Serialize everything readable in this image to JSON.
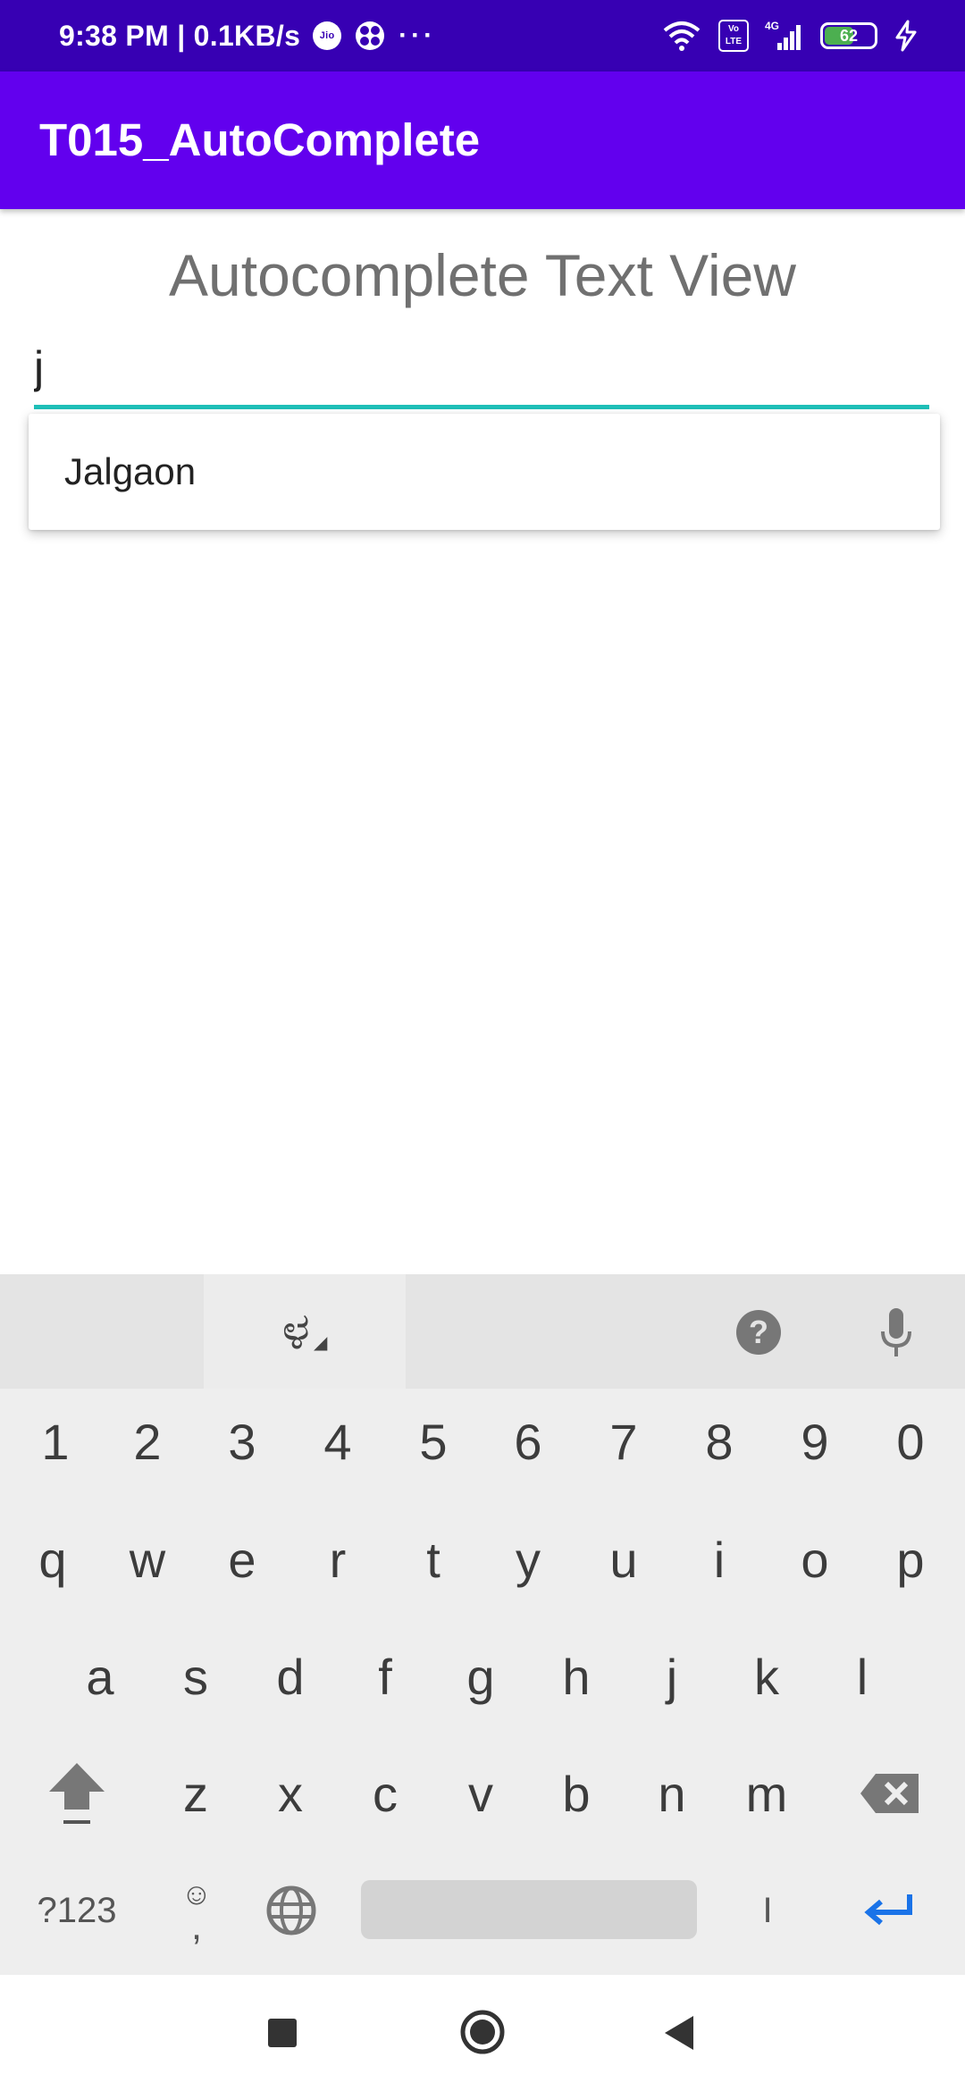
{
  "status_bar": {
    "time_speed": "9:38 PM | 0.1KB/s",
    "jio_label": "Jio",
    "more": "···",
    "volte_label": "Vo LTE",
    "network_label": "4G",
    "battery": "62",
    "battery_level": 0.62
  },
  "app_bar": {
    "title": "T015_AutoComplete"
  },
  "main": {
    "heading": "Autocomplete Text View",
    "input_value": "j",
    "suggestions": [
      "Jalgaon"
    ]
  },
  "keyboard": {
    "language_key": "ಳ",
    "help_label": "?",
    "digits": [
      "1",
      "2",
      "3",
      "4",
      "5",
      "6",
      "7",
      "8",
      "9",
      "0"
    ],
    "row_q": [
      "q",
      "w",
      "e",
      "r",
      "t",
      "y",
      "u",
      "i",
      "o",
      "p"
    ],
    "row_a": [
      "a",
      "s",
      "d",
      "f",
      "g",
      "h",
      "j",
      "k",
      "l"
    ],
    "row_z": [
      "z",
      "x",
      "c",
      "v",
      "b",
      "n",
      "m"
    ],
    "symbols_label": "?123",
    "emoji_label": "☺",
    "comma_label": ",",
    "period_label": "I",
    "icons": [
      "shift-icon",
      "backspace-icon",
      "globe-icon",
      "enter-icon",
      "mic-icon",
      "help-icon"
    ],
    "enter_color": "#1a73e8"
  },
  "nav_bar": {
    "icons": [
      "recents-icon",
      "home-icon",
      "back-icon"
    ]
  },
  "colors": {
    "status_bar": "#3700b3",
    "app_bar": "#6200ee",
    "accent": "#1fbfb8"
  }
}
